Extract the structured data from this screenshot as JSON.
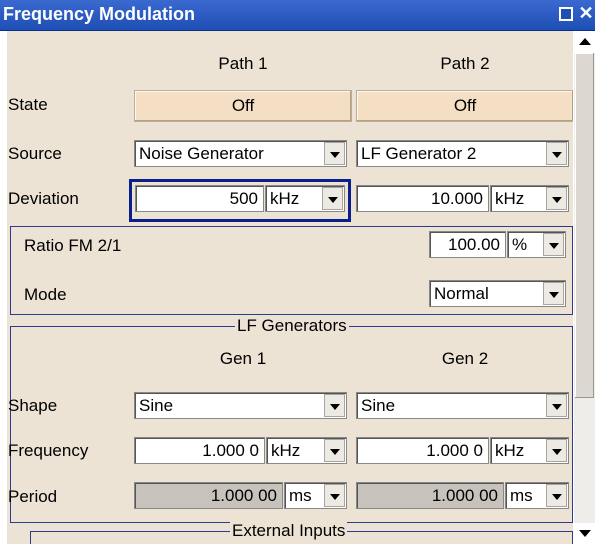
{
  "window": {
    "title": "Frequency Modulation"
  },
  "headers": {
    "path1": "Path 1",
    "path2": "Path 2"
  },
  "labels": {
    "state": "State",
    "source": "Source",
    "deviation": "Deviation",
    "ratio": "Ratio FM 2/1",
    "mode": "Mode",
    "shape": "Shape",
    "frequency": "Frequency",
    "period": "Period"
  },
  "path1": {
    "state": "Off",
    "source": "Noise Generator",
    "deviation_value": "500",
    "deviation_unit": "kHz"
  },
  "path2": {
    "state": "Off",
    "source": "LF Generator 2",
    "deviation_value": "10.000",
    "deviation_unit": "kHz"
  },
  "coupling": {
    "ratio_value": "100.00",
    "ratio_unit": "%",
    "mode": "Normal"
  },
  "lf_generators": {
    "legend": "LF Generators",
    "gen1_header": "Gen 1",
    "gen2_header": "Gen 2",
    "gen1": {
      "shape": "Sine",
      "frequency": "1.000 0",
      "frequency_unit": "kHz",
      "period": "1.000 00",
      "period_unit": "ms"
    },
    "gen2": {
      "shape": "Sine",
      "frequency": "1.000 0",
      "frequency_unit": "kHz",
      "period": "1.000 00",
      "period_unit": "ms"
    }
  },
  "external_inputs": {
    "legend": "External Inputs"
  },
  "icons": {
    "maximize": "maximize-icon",
    "close": "close-icon",
    "scroll_up": "arrow-up-icon",
    "scroll_down": "arrow-down-icon"
  }
}
